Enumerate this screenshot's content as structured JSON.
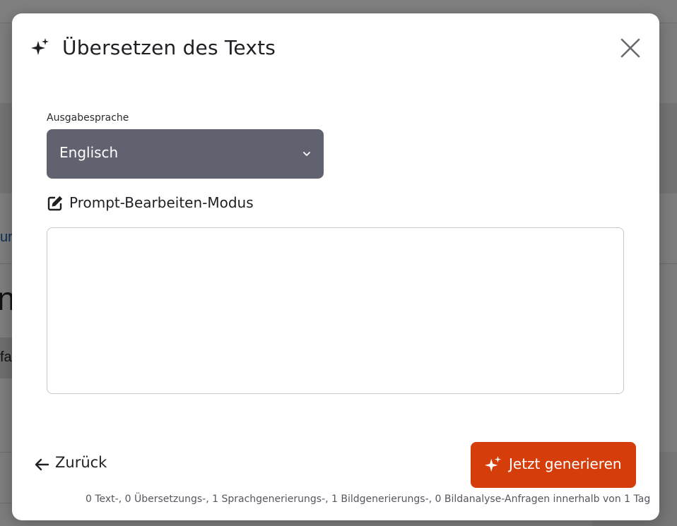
{
  "background": {
    "link_fragment": "ur",
    "heading_fragment": "n",
    "chip_fragment": "fa"
  },
  "modal": {
    "title": "Übersetzen des Texts",
    "title_icon": "sparkles-icon",
    "close_icon": "close-icon"
  },
  "form": {
    "language_label": "Ausgabesprache",
    "language_value": "Englisch",
    "prompt_toggle_label": "Prompt-Bearbeiten-Modus",
    "prompt_text": ""
  },
  "footer": {
    "back_label": "Zurück",
    "generate_label": "Jetzt generieren",
    "quota": "0 Text-, 0 Übersetzungs-, 1 Sprachgenerierungs-, 1 Bildgenerierungs-, 0 Bildanalyse-Anfragen innerhalb von 1 Tag"
  },
  "colors": {
    "accent": "#d53d0a",
    "select_bg": "#61626f"
  }
}
